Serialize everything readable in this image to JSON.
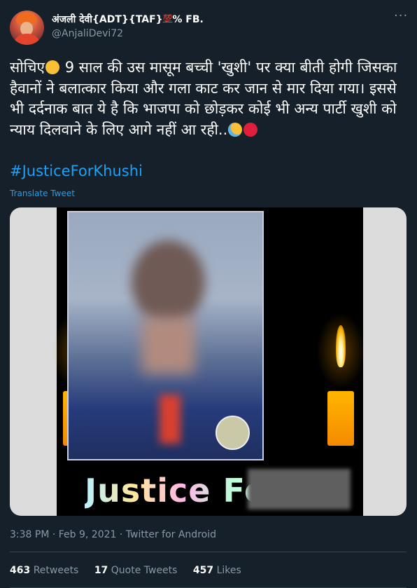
{
  "author": {
    "display_name": "अंजली देवी{ADT}{TAF}",
    "display_name_suffix": "% FB.",
    "hundred_emoji": "💯",
    "handle": "@AnjaliDevi72"
  },
  "more_icon": "more-horizontal-icon",
  "tweet": {
    "text_before_emoji": "सोचिए",
    "text_main": " 9 साल की उस मासूम बच्ची 'खुशी' पर क्या बीती होगी जिसका हैवानों ने बलात्कार किया और गला काट कर जान से मार दिया गया। इससे भी दर्दनाक बात ये है कि भाजपा को छोड़कर कोई भी अन्य पार्टी खुशी को न्याय दिलवाने के लिए आगे नहीं आ रही..",
    "hashtag": "#JusticeForKhushi",
    "translate_label": "Translate Tweet",
    "emojis": [
      "thinking-face",
      "crying-face",
      "angry-face"
    ]
  },
  "media": {
    "overlay_text": "Justice For"
  },
  "meta": {
    "timestamp": "3:38 PM · Feb 9, 2021 · Twitter for Android"
  },
  "stats": {
    "retweets_count": "463",
    "retweets_label": "Retweets",
    "quote_count": "17",
    "quote_label": "Quote Tweets",
    "likes_count": "457",
    "likes_label": "Likes"
  },
  "colors": {
    "background": "#15202b",
    "accent": "#1da1f2",
    "muted": "#8899a6"
  }
}
